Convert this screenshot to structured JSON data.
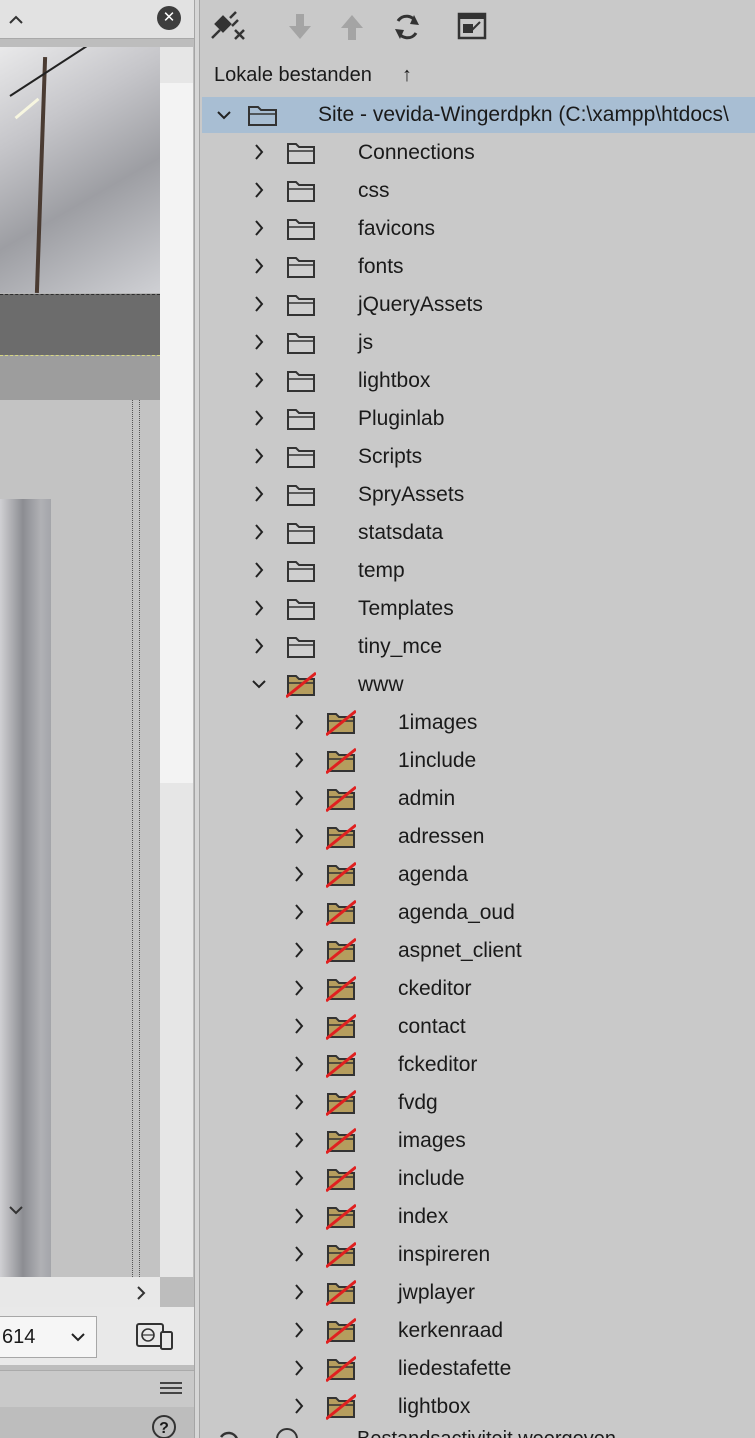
{
  "document": {
    "close_glyph": "✕",
    "size_value": "614"
  },
  "files_panel": {
    "header": "Lokale bestanden",
    "sort_glyph": "↑",
    "toolbar": [
      "connect-icon",
      "get-file-icon",
      "put-file-icon",
      "refresh-icon",
      "expand-panel-icon"
    ],
    "footer_text": "Bestandsactiviteit weergeven"
  },
  "tree": {
    "root": "Site - vevida-Wingerdpkn (C:\\xampp\\htdocs\\",
    "folders": [
      "Connections",
      "css",
      "favicons",
      "fonts",
      "jQueryAssets",
      "js",
      "lightbox",
      "Pluginlab",
      "Scripts",
      "SpryAssets",
      "statsdata",
      "temp",
      "Templates",
      "tiny_mce"
    ],
    "www": {
      "label": "www",
      "children": [
        "1images",
        "1include",
        "admin",
        "adressen",
        "agenda",
        "agenda_oud",
        "aspnet_client",
        "ckeditor",
        "contact",
        "fckeditor",
        "fvdg",
        "images",
        "include",
        "index",
        "inspireren",
        "jwplayer",
        "kerkenraad",
        "liedestafette",
        "lightbox"
      ]
    }
  },
  "colors": {
    "selection": "#a8bed3",
    "panel_bg": "#c9c9c9",
    "excluded_mark": "#e02020"
  }
}
